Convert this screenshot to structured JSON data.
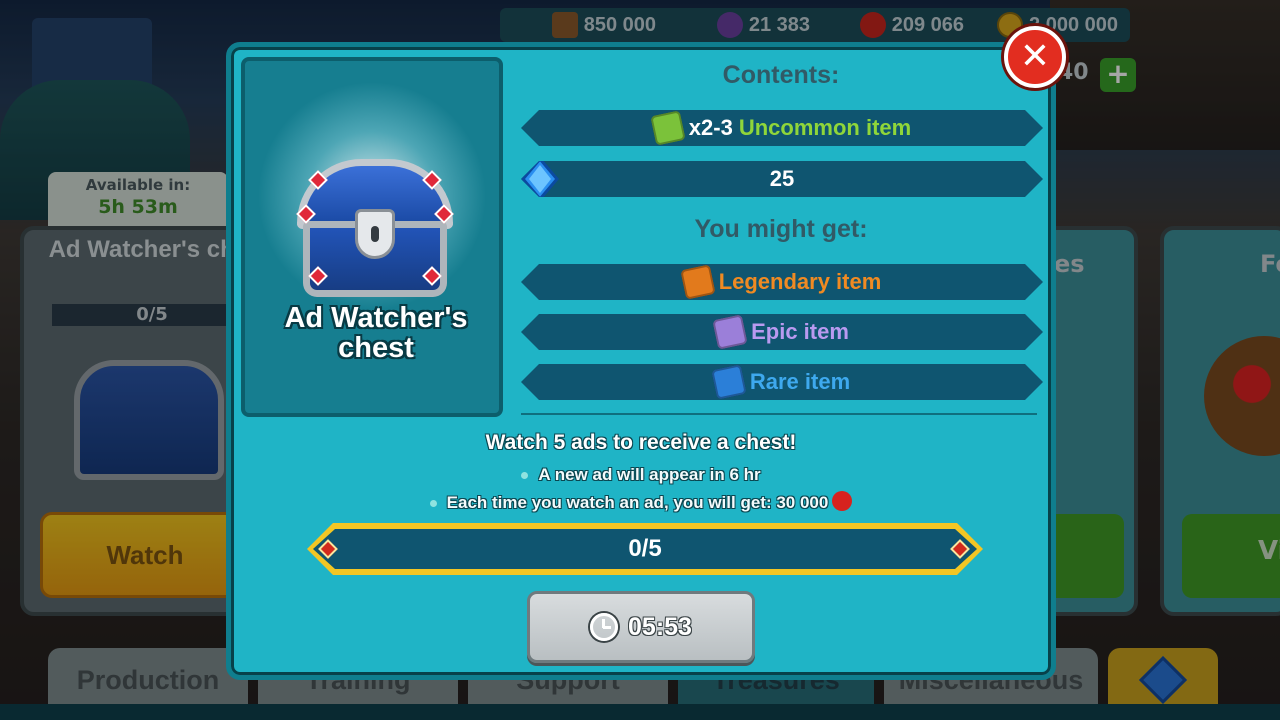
{
  "resources": {
    "wood": "850 000",
    "mana": "21 383",
    "apples": "209 066",
    "gold": "2 000 000"
  },
  "background": {
    "available_label": "Available in:",
    "available_value": "5h 53m",
    "card_left_title": "Ad Watcher's chest",
    "card_left_progress": "0/5",
    "card_left_button": "Watch",
    "card_mid_title_fragment": "es",
    "card_right_title_fragment": "Fo",
    "card_right_button_fragment": "Vi",
    "counter_fragment": "40"
  },
  "tabs": [
    {
      "label": "Production"
    },
    {
      "label": "Training"
    },
    {
      "label": "Support"
    },
    {
      "label": "Treasures"
    },
    {
      "label": "Miscellaneous"
    }
  ],
  "modal": {
    "chest_name": "Ad Watcher's\nchest",
    "contents_heading": "Contents:",
    "contents": [
      {
        "quantity": "x2-3",
        "label": "Uncommon item",
        "icon": "uncommon-item-icon"
      },
      {
        "label": "25",
        "icon": "gem-icon"
      }
    ],
    "might_get_heading": "You might get:",
    "might_get": [
      {
        "label": "Legendary item",
        "icon": "legendary-item-icon"
      },
      {
        "label": "Epic item",
        "icon": "epic-item-icon"
      },
      {
        "label": "Rare item",
        "icon": "rare-item-icon"
      }
    ],
    "watch_title": "Watch 5 ads to receive a chest!",
    "bullet_new_ad": "A new ad will appear in 6 hr",
    "bullet_reward": "Each time you watch an ad, you will get: 30 000",
    "progress_label": "0/5",
    "progress_value": 0,
    "progress_max": 5,
    "timer_label": "05:53",
    "close_label": "✕"
  },
  "colors": {
    "modal_bg": "#1fb4c6",
    "ribbon": "#0f5570",
    "uncommon": "#8fd63a",
    "legendary": "#f08a22",
    "epic": "#b99af0",
    "rare": "#3ea9ee",
    "close": "#e22d20",
    "progress_frame": "#f3c624"
  }
}
